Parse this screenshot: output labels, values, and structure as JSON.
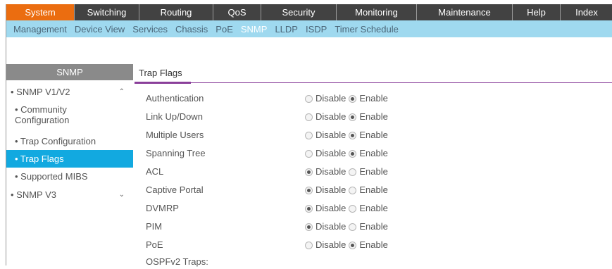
{
  "topnav": {
    "tabs": [
      {
        "label": "System",
        "active": true
      },
      {
        "label": "Switching",
        "active": false
      },
      {
        "label": "Routing",
        "active": false
      },
      {
        "label": "QoS",
        "active": false
      },
      {
        "label": "Security",
        "active": false
      },
      {
        "label": "Monitoring",
        "active": false
      },
      {
        "label": "Maintenance",
        "active": false
      },
      {
        "label": "Help",
        "active": false
      },
      {
        "label": "Index",
        "active": false
      }
    ]
  },
  "subnav": {
    "items": [
      {
        "label": "Management",
        "active": false
      },
      {
        "label": "Device View",
        "active": false
      },
      {
        "label": "Services",
        "active": false
      },
      {
        "label": "Chassis",
        "active": false
      },
      {
        "label": "PoE",
        "active": false
      },
      {
        "label": "SNMP",
        "active": true
      },
      {
        "label": "LLDP",
        "active": false
      },
      {
        "label": "ISDP",
        "active": false
      },
      {
        "label": "Timer Schedule",
        "active": false
      }
    ]
  },
  "sidebar": {
    "title": "SNMP",
    "items": [
      {
        "label": "• SNMP V1/V2",
        "level": 1,
        "chevron": "^"
      },
      {
        "label": "• Community\nConfiguration",
        "level": 2
      },
      {
        "label": "• Trap Configuration",
        "level": 2
      },
      {
        "label": "• Trap Flags",
        "level": 2,
        "active": true
      },
      {
        "label": "• Supported MIBS",
        "level": 2
      },
      {
        "label": "• SNMP V3",
        "level": 1,
        "chevron": "v"
      }
    ]
  },
  "content": {
    "tab": "Trap Flags",
    "options": {
      "disable": "Disable",
      "enable": "Enable"
    },
    "rows": [
      {
        "label": "Authentication",
        "selected": "enable"
      },
      {
        "label": "Link Up/Down",
        "selected": "enable"
      },
      {
        "label": "Multiple Users",
        "selected": "enable"
      },
      {
        "label": "Spanning Tree",
        "selected": "enable"
      },
      {
        "label": "ACL",
        "selected": "disable"
      },
      {
        "label": "Captive Portal",
        "selected": "disable"
      },
      {
        "label": "DVMRP",
        "selected": "disable"
      },
      {
        "label": "PIM",
        "selected": "disable"
      },
      {
        "label": "PoE",
        "selected": "enable"
      }
    ],
    "ospf_label": "OSPFv2 Traps:"
  }
}
